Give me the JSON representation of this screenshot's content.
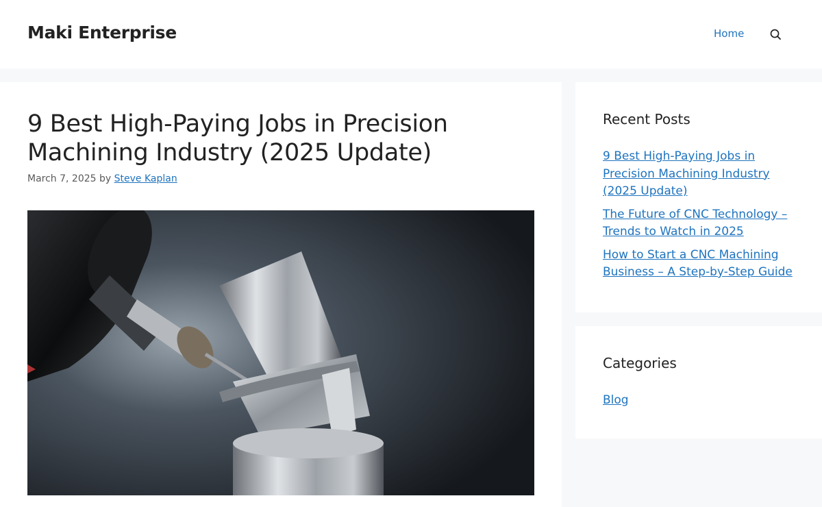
{
  "header": {
    "site_title": "Maki Enterprise",
    "nav": {
      "home_label": "Home",
      "search_icon": "search-icon"
    }
  },
  "post": {
    "title": "9 Best High-Paying Jobs in Precision Machining Industry (2025 Update)",
    "date": "March 7, 2025",
    "by_label": "by",
    "author": "Steve Kaplan",
    "featured_image": "cnc-milling-machine-photo"
  },
  "sidebar": {
    "recent_posts": {
      "title": "Recent Posts",
      "items": [
        {
          "label": "9 Best High-Paying Jobs in Precision Machining Industry (2025 Update)"
        },
        {
          "label": "The Future of CNC Technology – Trends to Watch in 2025"
        },
        {
          "label": "How to Start a CNC Machining Business – A Step-by-Step Guide"
        }
      ]
    },
    "categories": {
      "title": "Categories",
      "items": [
        {
          "label": "Blog"
        }
      ]
    }
  },
  "colors": {
    "link": "#1e73be",
    "text": "#222222",
    "meta": "#595959",
    "page_background": "#f7f8f9"
  }
}
